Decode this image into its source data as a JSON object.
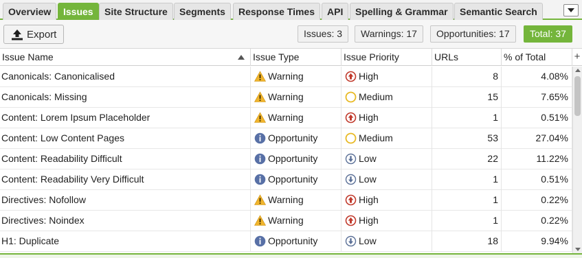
{
  "tabs": [
    {
      "label": "Overview",
      "active": false
    },
    {
      "label": "Issues",
      "active": true
    },
    {
      "label": "Site Structure",
      "active": false
    },
    {
      "label": "Segments",
      "active": false
    },
    {
      "label": "Response Times",
      "active": false
    },
    {
      "label": "API",
      "active": false
    },
    {
      "label": "Spelling & Grammar",
      "active": false
    },
    {
      "label": "Semantic Search",
      "active": false
    }
  ],
  "toolbar": {
    "export_label": "Export",
    "export_icon": "upload-icon",
    "counters": {
      "issues": "Issues: 3",
      "warnings": "Warnings: 17",
      "opportunities": "Opportunities: 17",
      "total": "Total: 37"
    }
  },
  "table": {
    "columns": [
      "Issue Name",
      "Issue Type",
      "Issue Priority",
      "URLs",
      "% of Total"
    ],
    "sort": {
      "column": "Issue Name",
      "direction": "ascending"
    },
    "rows": [
      {
        "name": "Canonicals: Canonicalised",
        "type": "Warning",
        "priority": "High",
        "urls": "8",
        "pct": "4.08%"
      },
      {
        "name": "Canonicals: Missing",
        "type": "Warning",
        "priority": "Medium",
        "urls": "15",
        "pct": "7.65%"
      },
      {
        "name": "Content: Lorem Ipsum Placeholder",
        "type": "Warning",
        "priority": "High",
        "urls": "1",
        "pct": "0.51%"
      },
      {
        "name": "Content: Low Content Pages",
        "type": "Opportunity",
        "priority": "Medium",
        "urls": "53",
        "pct": "27.04%"
      },
      {
        "name": "Content: Readability Difficult",
        "type": "Opportunity",
        "priority": "Low",
        "urls": "22",
        "pct": "11.22%"
      },
      {
        "name": "Content: Readability Very Difficult",
        "type": "Opportunity",
        "priority": "Low",
        "urls": "1",
        "pct": "0.51%"
      },
      {
        "name": "Directives: Nofollow",
        "type": "Warning",
        "priority": "High",
        "urls": "1",
        "pct": "0.22%"
      },
      {
        "name": "Directives: Noindex",
        "type": "Warning",
        "priority": "High",
        "urls": "1",
        "pct": "0.22%"
      },
      {
        "name": "H1: Duplicate",
        "type": "Opportunity",
        "priority": "Low",
        "urls": "18",
        "pct": "9.94%"
      }
    ]
  },
  "icons": {
    "Warning": "warning-icon",
    "Opportunity": "info-icon",
    "High": "priority-high-icon",
    "Medium": "priority-medium-icon",
    "Low": "priority-low-icon"
  },
  "colors": {
    "accent": "#74b53b",
    "warning": "#f1b52d",
    "opportunity": "#5870a6",
    "high": "#c0392b",
    "medium": "#e8b923",
    "low": "#5a6f96"
  }
}
